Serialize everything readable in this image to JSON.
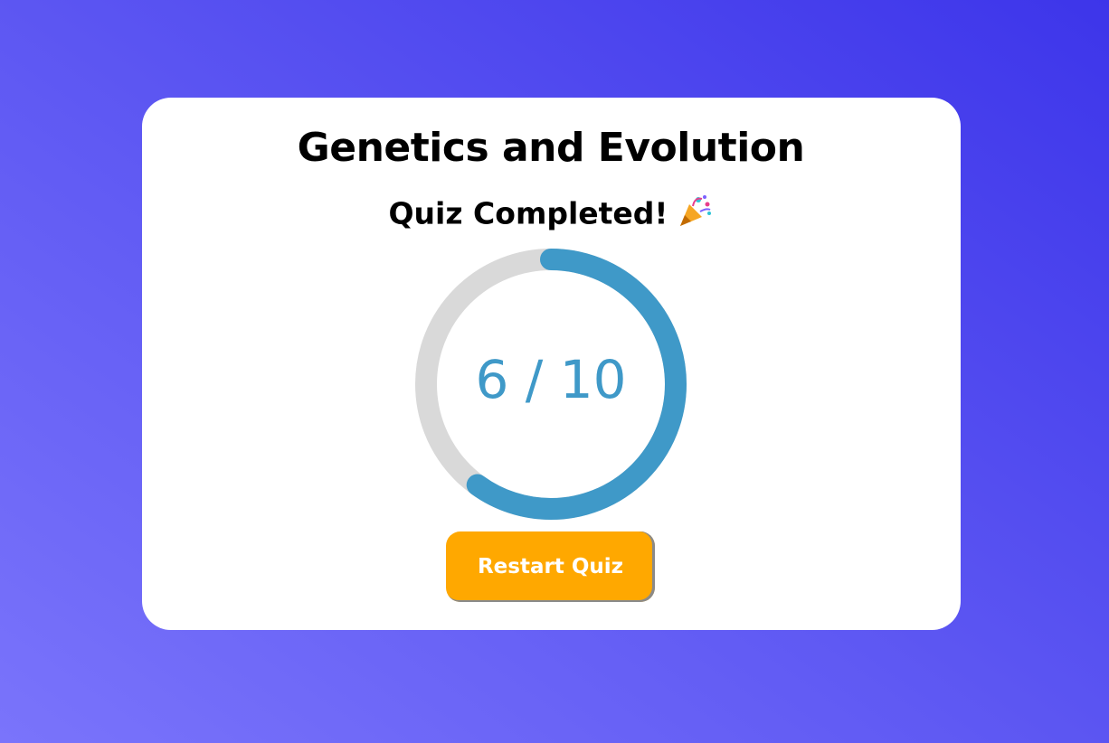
{
  "quiz": {
    "title": "Genetics and Evolution",
    "status": "Quiz Completed!",
    "party_icon": "party-popper-icon"
  },
  "result": {
    "score_text": "6 / 10",
    "correct": 6,
    "total": 10,
    "progress_fraction": 0.6
  },
  "actions": {
    "restart_label": "Restart Quiz"
  },
  "colors": {
    "progress": "#3f99c8",
    "track": "#d9d9d9",
    "button": "#ffa800",
    "background_start": "#7a74fb",
    "background_end": "#3d35ea"
  }
}
